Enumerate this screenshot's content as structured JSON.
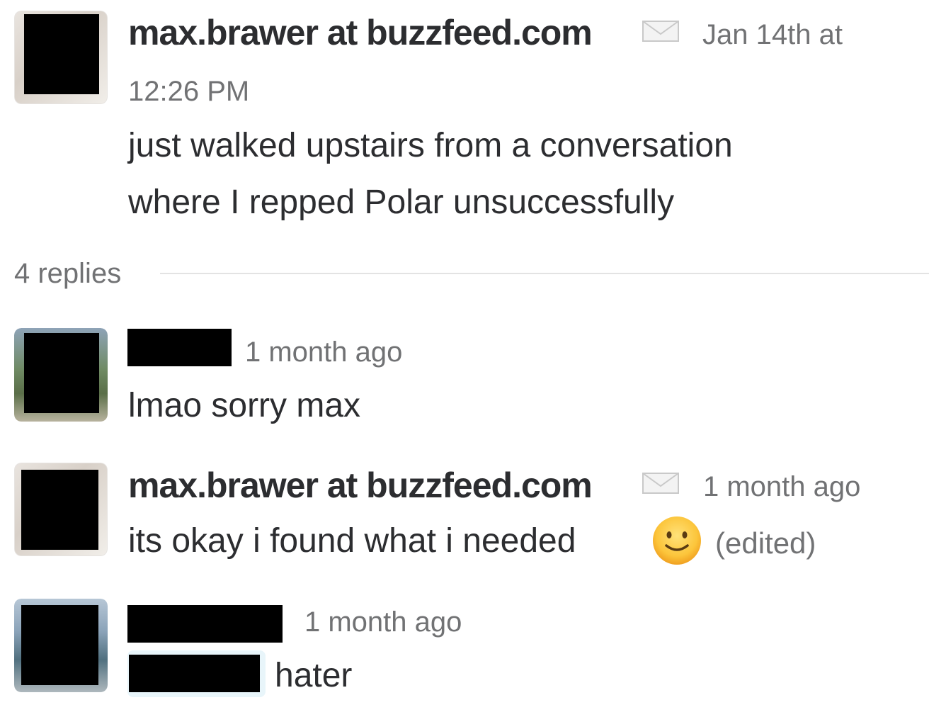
{
  "thread": {
    "parent": {
      "author": "max.brawer at buzzfeed.com",
      "author_icon": "envelope-icon",
      "timestamp_line1": "Jan 14th at",
      "timestamp_line2": "12:26 PM",
      "text_line1": "just walked upstairs from a conversation",
      "text_line2": "where I repped Polar unsuccessfully"
    },
    "replies_count_label": "4 replies",
    "replies": [
      {
        "author": "",
        "author_redacted": true,
        "timestamp": "1 month ago",
        "text": "lmao sorry max"
      },
      {
        "author": "max.brawer at buzzfeed.com",
        "author_icon": "envelope-icon",
        "timestamp": "1 month ago",
        "text": "its okay i found what i needed",
        "emoji": "slightly-smiling-face-icon",
        "edited_label": "(edited)"
      },
      {
        "author": "",
        "author_redacted": true,
        "timestamp": "1 month ago",
        "mention_redacted": true,
        "text": "hater"
      }
    ]
  },
  "colors": {
    "text_primary": "#2c2d30",
    "text_secondary": "#717274",
    "divider": "#e3e3e3",
    "redaction": "#000000"
  }
}
